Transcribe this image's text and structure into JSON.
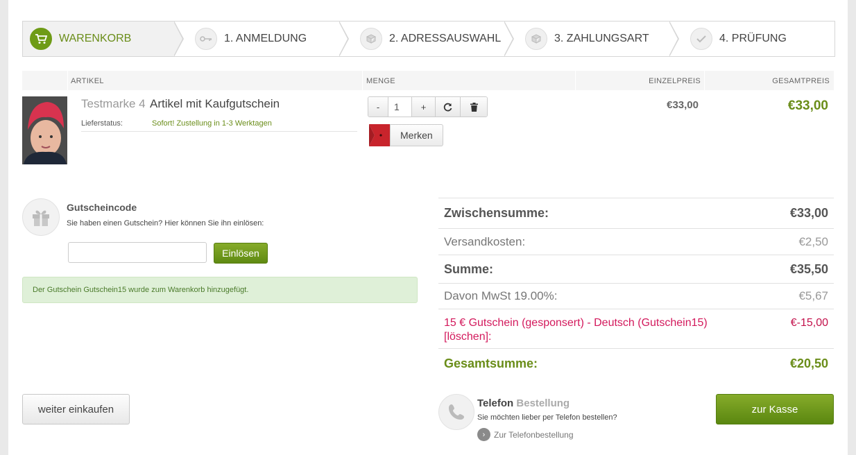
{
  "steps": [
    {
      "label": "WARENKORB",
      "icon": "cart-icon",
      "active": true
    },
    {
      "label": "1. ANMELDUNG",
      "icon": "key-icon"
    },
    {
      "label": "2. ADRESSAUSWAHL",
      "icon": "box-icon"
    },
    {
      "label": "3. ZAHLUNGSART",
      "icon": "box-icon"
    },
    {
      "label": "4. PRÜFUNG",
      "icon": "check-icon"
    }
  ],
  "table_header": {
    "article": "ARTIKEL",
    "quantity": "MENGE",
    "unit_price": "EINZELPREIS",
    "total_price": "GESAMTPREIS"
  },
  "item": {
    "brand": "Testmarke 4",
    "name": "Artikel mit Kaufgutschein",
    "status_label": "Lieferstatus:",
    "status_value": "Sofort! Zustellung in 1-3 Werktagen",
    "quantity": "1",
    "decrement": "-",
    "increment": "+",
    "merken": "Merken",
    "unit_price": "€33,00",
    "total_price": "€33,00"
  },
  "coupon": {
    "title": "Gutscheincode",
    "subtitle": "Sie haben einen Gutschein? Hier können Sie ihn einlösen:",
    "input_value": "",
    "button": "Einlösen",
    "notice": "Der Gutschein Gutschein15 wurde zum Warenkorb hinzugefügt."
  },
  "summary": {
    "subtotal_label": "Zwischensumme:",
    "subtotal_value": "€33,00",
    "shipping_label": "Versandkosten:",
    "shipping_value": "€2,50",
    "sum_label": "Summe:",
    "sum_value": "€35,50",
    "tax_label": "Davon MwSt 19.00%:",
    "tax_value": "€5,67",
    "coupon_label": "15 € Gutschein (gesponsert) - Deutsch (Gutschein15) [löschen]:",
    "coupon_value": "€-15,00",
    "grand_label": "Gesamtsumme:",
    "grand_value": "€20,50"
  },
  "bottom": {
    "continue": "weiter einkaufen",
    "phone_title": "Telefon",
    "phone_title_suffix": "Bestellung",
    "phone_sub": "Sie möchten lieber per Telefon bestellen?",
    "phone_link": "Zur Telefonbestellung",
    "checkout": "zur Kasse"
  },
  "colors": {
    "accent_green": "#6a8d19",
    "coupon_red": "#d3195c",
    "notice_bg": "#dff0d8"
  }
}
